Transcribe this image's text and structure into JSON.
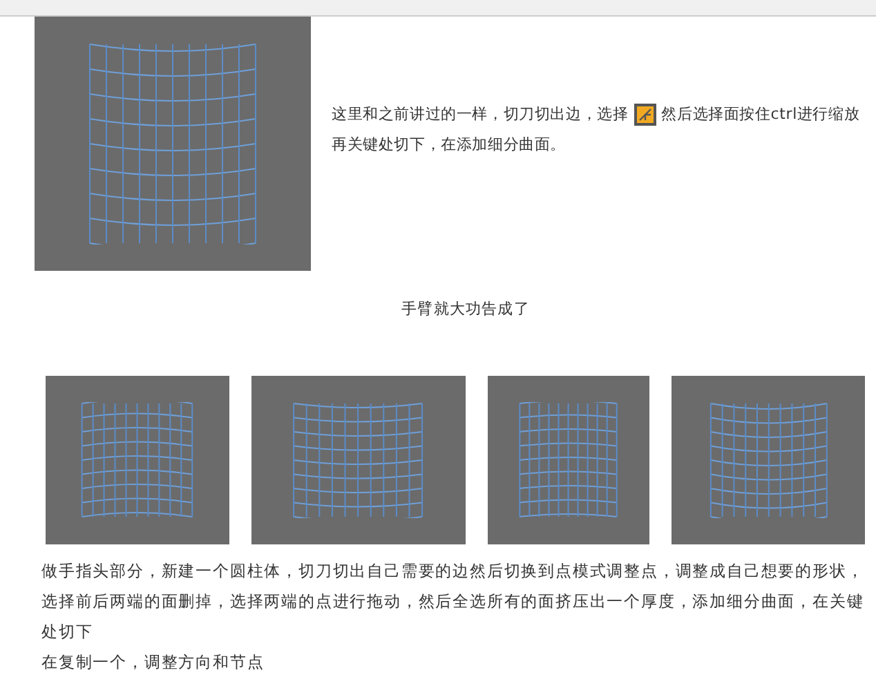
{
  "intro": {
    "text_before": "这里和之前讲过的一样，切刀切出边，选择",
    "text_after": "然后选择面按住ctrl进行缩放",
    "line_2": "再关键处切下，在添加细分曲面。"
  },
  "caption": "手臂就大功告成了",
  "finger_paragraphs": [
    "做手指头部分，新建一个圆柱体，切刀切出自己需要的边然后切换到点模式调整点，调整成自己想要的形状，选择前后两端的面删掉，选择两端的点进行拖动，然后全选所有的面挤压出一个厚度，添加细分曲面，在关键处切下",
    "在复制一个，调整方向和节点"
  ]
}
